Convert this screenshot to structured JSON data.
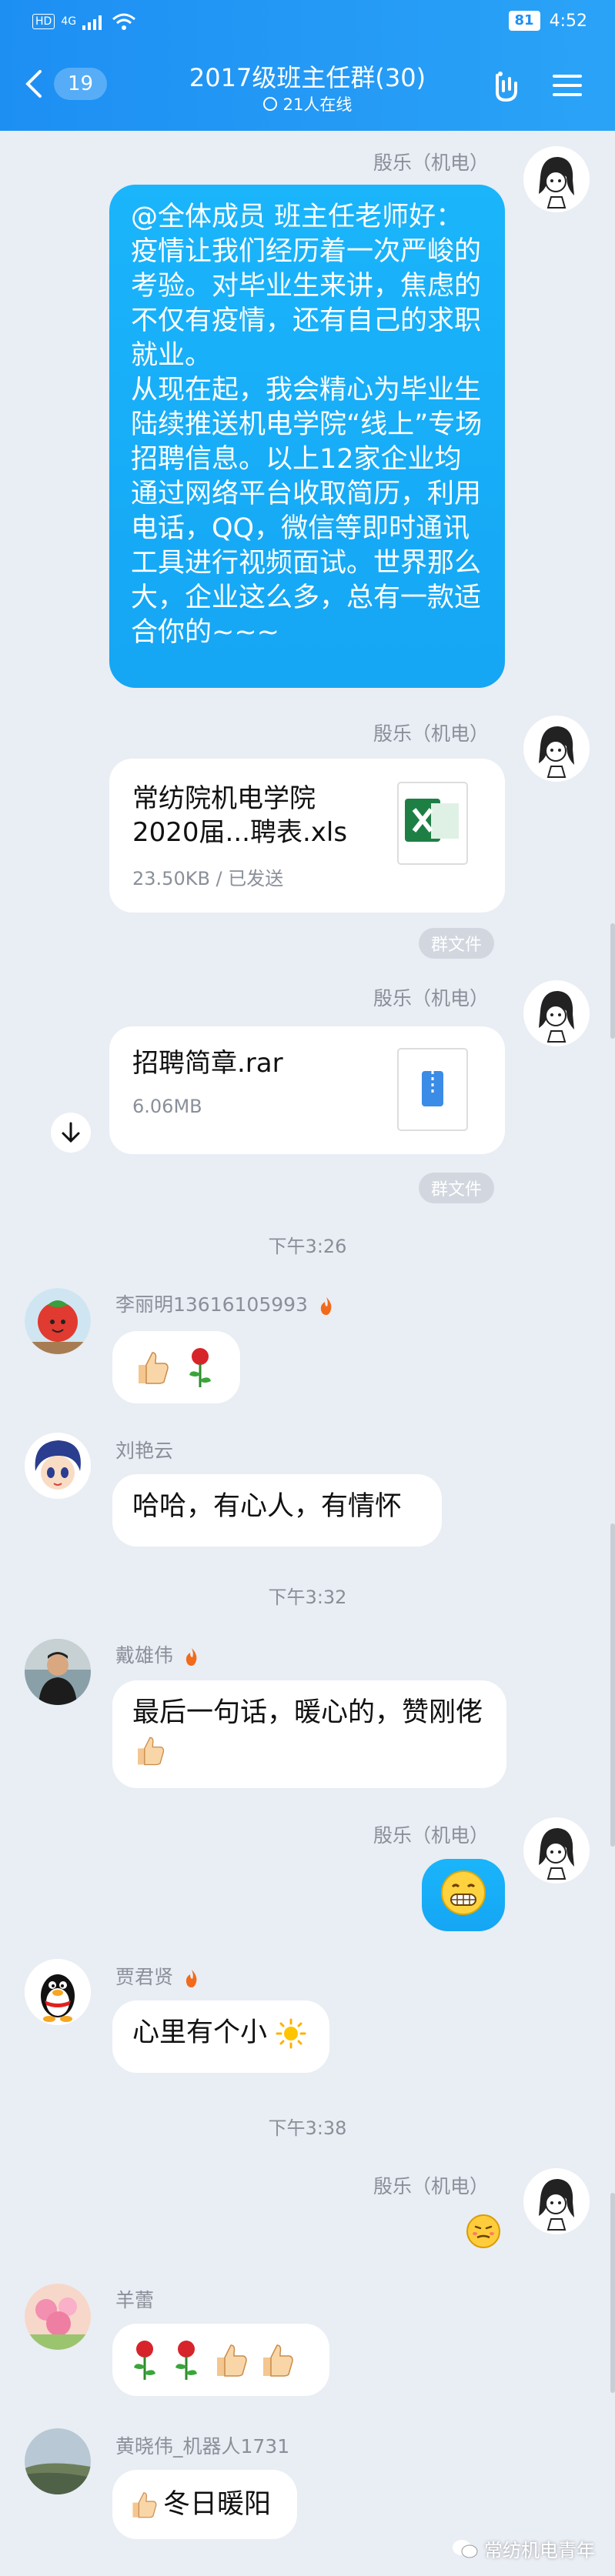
{
  "status_bar": {
    "left_icons": [
      "HD",
      "4G",
      "signal",
      "wifi"
    ],
    "battery": "81",
    "time": "4:52"
  },
  "header": {
    "unread_count": "19",
    "title": "2017级班主任群(30)",
    "online": "21人在线",
    "bg_color": "#1d8ff3"
  },
  "messages": {
    "m1": {
      "sender": "殷乐（机电）",
      "text": "@全体成员 班主任老师好：疫情让我们经历着一次严峻的考验。对毕业生来讲，焦虑的不仅有疫情，还有自己的求职就业。\n从现在起，我会精心为毕业生陆续推送机电学院“线上”专场招聘信息。以上12家企业均通过网络平台收取简历，利用电话，QQ，微信等即时通讯工具进行视频面试。世界那么大，企业这么多，总有一款适合你的~~~"
    },
    "m2": {
      "sender": "殷乐（机电）",
      "file_name": "常纺院机电学院2020届...聘表.xls",
      "file_meta": "23.50KB / 已发送",
      "tag": "群文件"
    },
    "m3": {
      "sender": "殷乐（机电）",
      "file_name": "招聘简章.rar",
      "file_meta": "6.06MB",
      "tag": "群文件"
    },
    "time1": "下午3:26",
    "m4": {
      "sender": "李丽明13616105993"
    },
    "m5": {
      "sender": "刘艳云",
      "text": "哈哈，有心人，有情怀"
    },
    "time2": "下午3:32",
    "m6": {
      "sender": "戴雄伟",
      "text": "最后一句话，暖心的，赞刚佬"
    },
    "m7": {
      "sender": "殷乐（机电）"
    },
    "m8": {
      "sender": "贾君贤",
      "text": "心里有个小"
    },
    "time3": "下午3:38",
    "m9": {
      "sender": "殷乐（机电）"
    },
    "m10": {
      "sender": "羊蕾"
    },
    "m11": {
      "sender": "黄晓伟_机器人1731",
      "text": "冬日暖阳"
    }
  },
  "watermark": "常纺机电青年",
  "colors": {
    "bubble_blue": "#15a6f4",
    "background": "#e9edf4"
  }
}
